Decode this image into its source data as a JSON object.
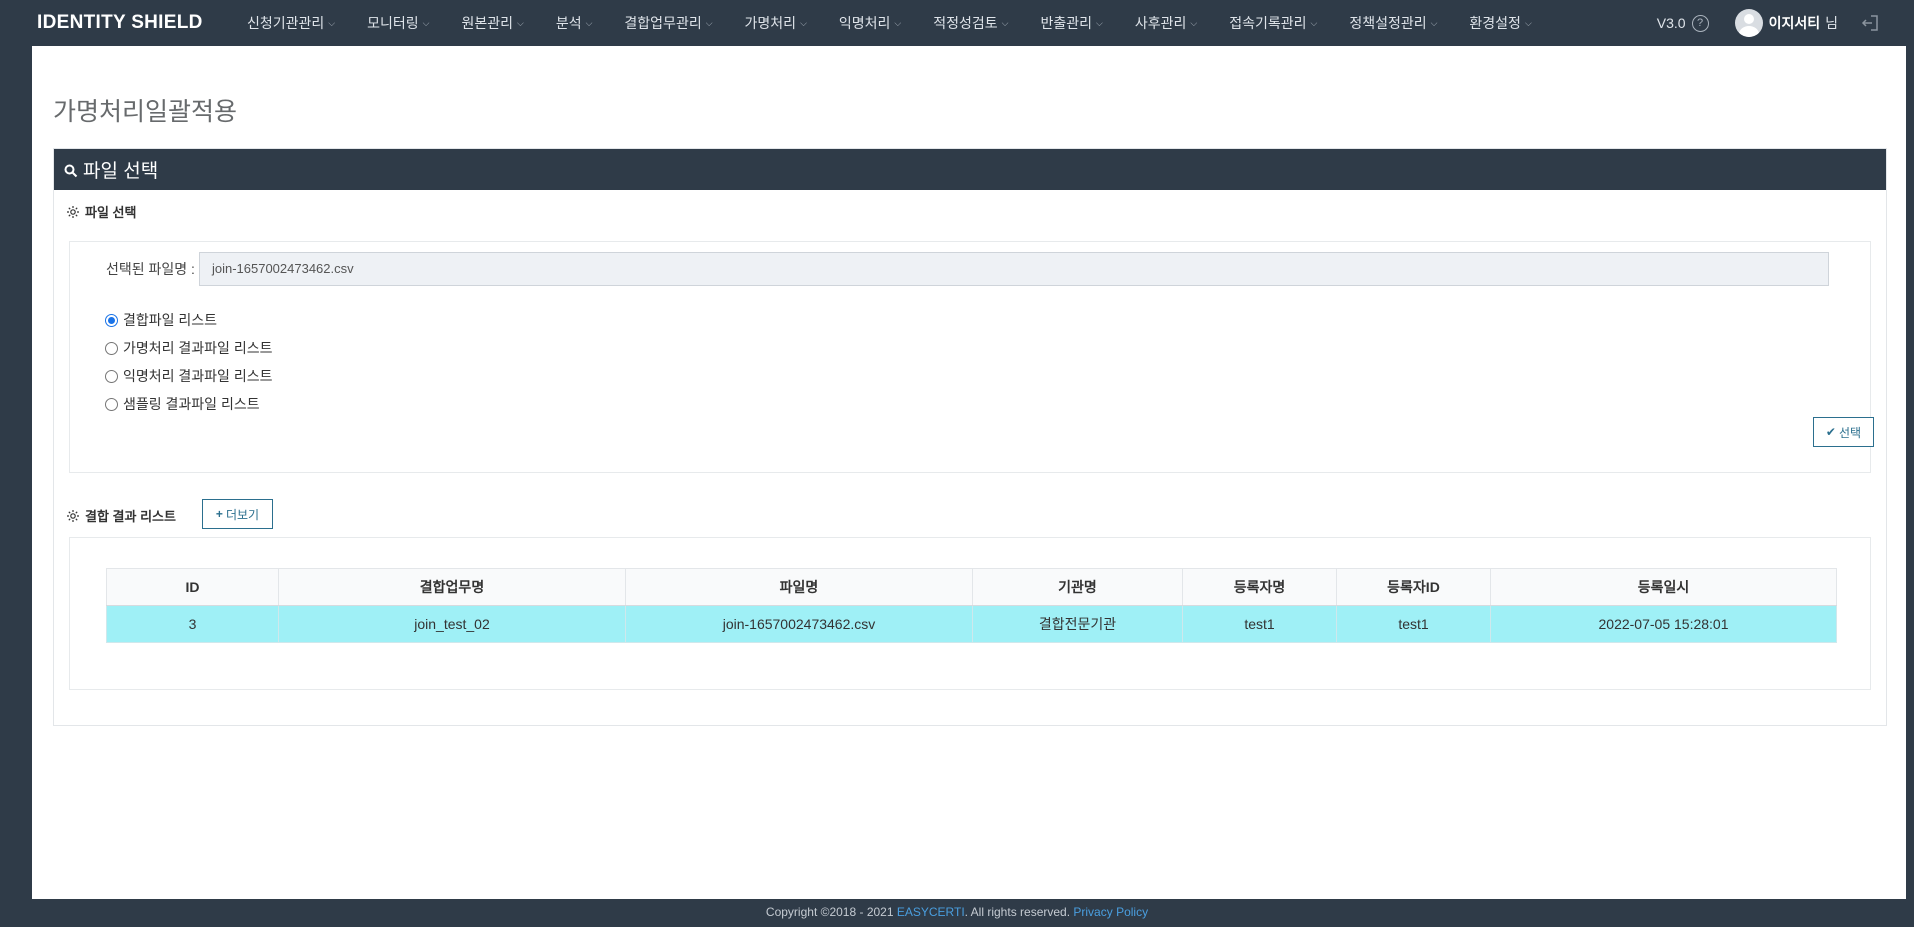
{
  "app": {
    "brand": "IDENTITY SHIELD"
  },
  "nav": {
    "items": [
      "신청기관관리",
      "모니터링",
      "원본관리",
      "분석",
      "결합업무관리",
      "가명처리",
      "익명처리",
      "적정성검토",
      "반출관리",
      "사후관리",
      "접속기록관리",
      "정책설정관리",
      "환경설정"
    ],
    "version": "V3.0",
    "help_glyph": "?",
    "user_name": "이지서티",
    "user_suffix": "님"
  },
  "page": {
    "title": "가명처리일괄적용"
  },
  "panel": {
    "heading": "파일 선택"
  },
  "file_section": {
    "label": "파일 선택",
    "selected_file_label": "선택된 파일명 :",
    "selected_file_value": "join-1657002473462.csv",
    "radio_options": [
      {
        "label": "결합파일 리스트",
        "checked": true
      },
      {
        "label": "가명처리 결과파일 리스트",
        "checked": false
      },
      {
        "label": "익명처리 결과파일 리스트",
        "checked": false
      },
      {
        "label": "샘플링 결과파일 리스트",
        "checked": false
      }
    ],
    "select_button": "선택",
    "select_icon": "✔"
  },
  "result_section": {
    "label": "결합 결과 리스트",
    "more_button": "더보기",
    "more_icon": "+",
    "columns": [
      "ID",
      "결합업무명",
      "파일명",
      "기관명",
      "등록자명",
      "등록자ID",
      "등록일시"
    ],
    "rows": [
      [
        "3",
        "join_test_02",
        "join-1657002473462.csv",
        "결합전문기관",
        "test1",
        "test1",
        "2022-07-05 15:28:01"
      ]
    ]
  },
  "footer": {
    "copyright": "Copyright ©2018 - 2021",
    "company": "EASYCERTI",
    "rights": ". All rights reserved.",
    "privacy": "Privacy Policy"
  },
  "colors": {
    "navbar": "#2f3b48",
    "accent": "#2b6f8e",
    "row_highlight": "#9ff0f6",
    "link": "#4a9fe0"
  }
}
